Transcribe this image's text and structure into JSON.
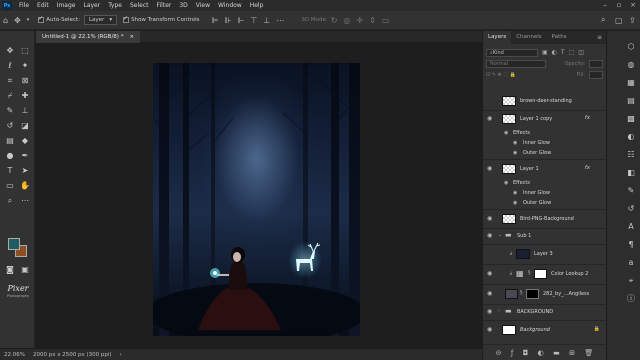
{
  "menu": [
    "File",
    "Edit",
    "Image",
    "Layer",
    "Type",
    "Select",
    "Filter",
    "3D",
    "View",
    "Window",
    "Help"
  ],
  "app_logo": "Ps",
  "options": {
    "auto_select_label": "Auto-Select:",
    "auto_select_value": "Layer",
    "show_transform_label": "Show Transform Controls",
    "mode_3d_label": "3D Mode:"
  },
  "document": {
    "tab_title": "Untitled-1 @ 22.1% (RGB/8) *",
    "tab_close": "×"
  },
  "status": {
    "zoom": "22.06%",
    "doc_info": "2000 px x 2500 px (300 ppi)"
  },
  "watermark": {
    "line1": "Pixer",
    "line2": "Photography"
  },
  "panel": {
    "tabs": [
      "Layers",
      "Channels",
      "Paths"
    ],
    "kind_label": "Kind",
    "blend_mode": "Normal",
    "opacity_label": "Opacity:",
    "fill_label": "Fill:"
  },
  "layers": [
    {
      "name": "brown-deer-standing",
      "visible": false,
      "fx": false
    },
    {
      "name": "Layer 1 copy",
      "visible": true,
      "fx": true
    },
    {
      "name": "Effects",
      "visible": true,
      "fx": false
    },
    {
      "name": "Inner Glow",
      "visible": true,
      "fx": false
    },
    {
      "name": "Outer Glow",
      "visible": true,
      "fx": false
    },
    {
      "name": "Layer 1",
      "visible": true,
      "fx": true
    },
    {
      "name": "Effects",
      "visible": true,
      "fx": false
    },
    {
      "name": "Inner Glow",
      "visible": true,
      "fx": false
    },
    {
      "name": "Outer Glow",
      "visible": true,
      "fx": false
    },
    {
      "name": "Bird-PNG-Background",
      "visible": true,
      "fx": false
    },
    {
      "name": "Sub 1",
      "visible": true,
      "fx": false
    },
    {
      "name": "Layer 3",
      "visible": false,
      "fx": false
    },
    {
      "name": "Color Lookup 2",
      "visible": true,
      "fx": false
    },
    {
      "name": "282_by_...Angiless",
      "visible": true,
      "fx": false
    },
    {
      "name": "BACKGROUND",
      "visible": true,
      "fx": false
    },
    {
      "name": "Background",
      "visible": true,
      "fx": false
    }
  ],
  "fx_label": "fx",
  "colors": {
    "foreground": "#1f5c63",
    "background": "#8b4e25",
    "accent": "#2fa3ff"
  }
}
